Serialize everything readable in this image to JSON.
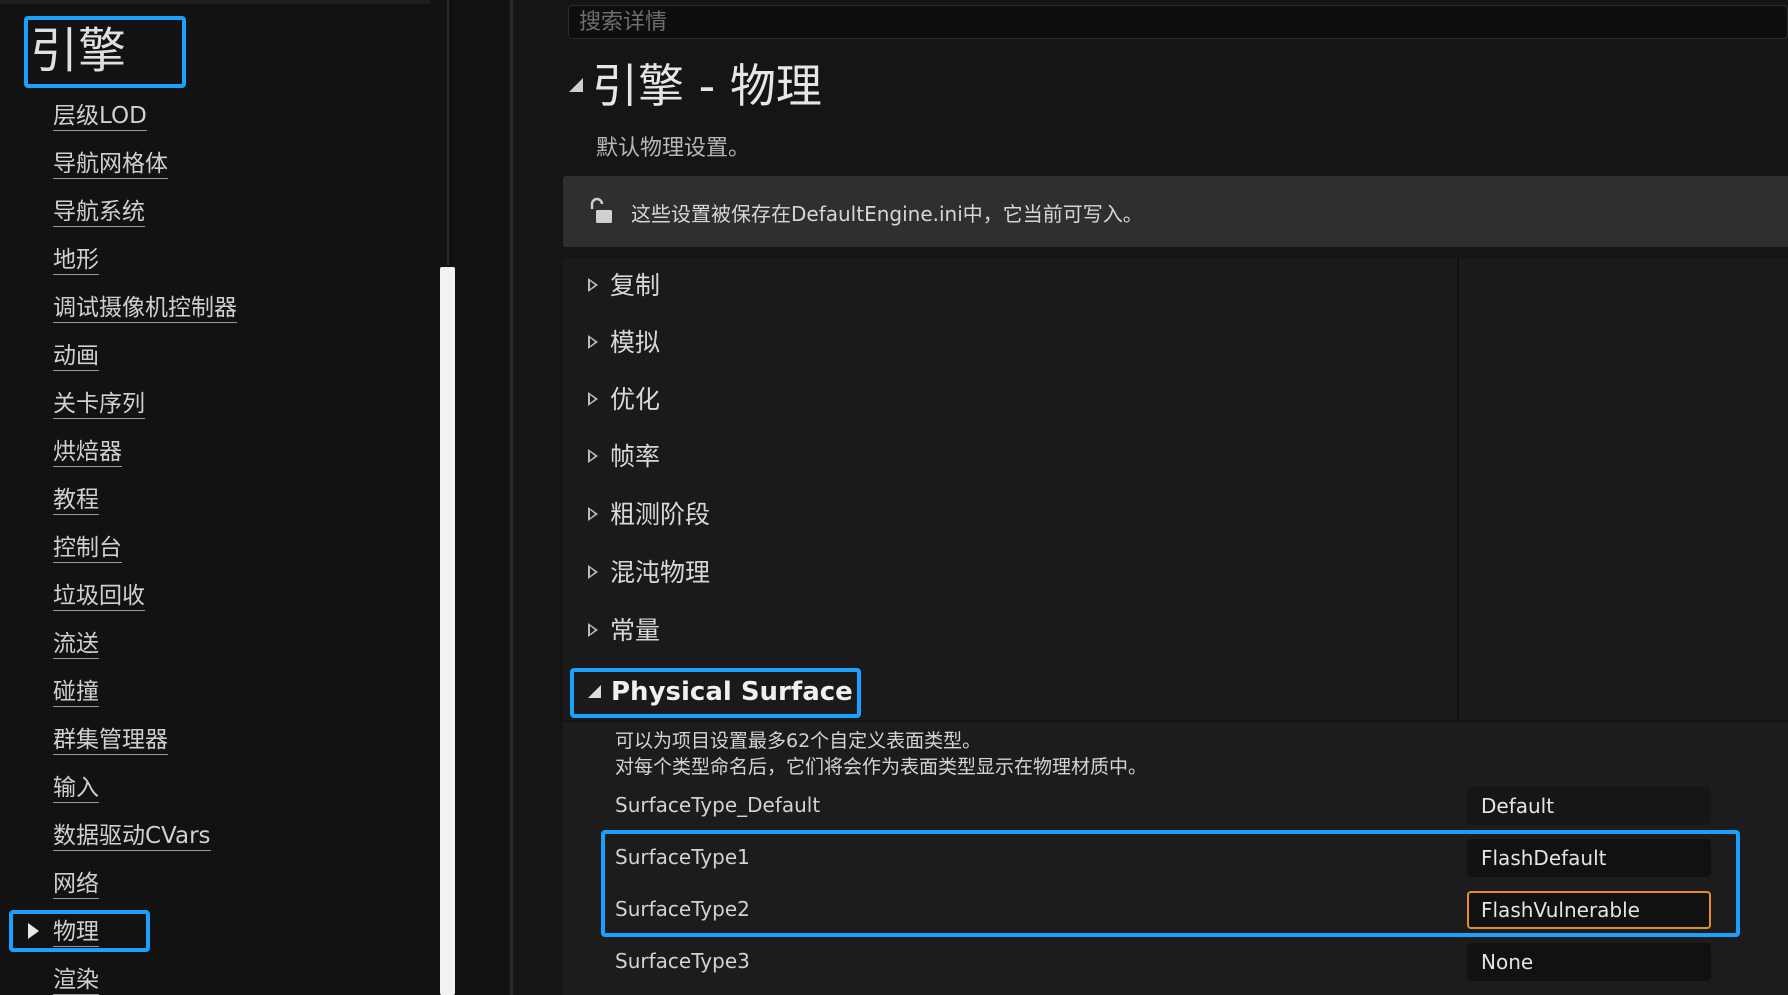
{
  "sidebar": {
    "section_title": "引擎",
    "items": [
      {
        "label": "层级LOD"
      },
      {
        "label": "导航网格体"
      },
      {
        "label": "导航系统"
      },
      {
        "label": "地形"
      },
      {
        "label": "调试摄像机控制器"
      },
      {
        "label": "动画"
      },
      {
        "label": "关卡序列"
      },
      {
        "label": "烘焙器"
      },
      {
        "label": "教程"
      },
      {
        "label": "控制台"
      },
      {
        "label": "垃圾回收"
      },
      {
        "label": "流送"
      },
      {
        "label": "碰撞"
      },
      {
        "label": "群集管理器"
      },
      {
        "label": "输入"
      },
      {
        "label": "数据驱动CVars"
      },
      {
        "label": "网络"
      },
      {
        "label": "物理",
        "active": true
      },
      {
        "label": "渲染"
      }
    ]
  },
  "search": {
    "placeholder": "搜索详情",
    "value": ""
  },
  "page": {
    "title": "引擎 - 物理",
    "description": "默认物理设置。"
  },
  "notice": {
    "icon": "unlock-icon",
    "text": "这些设置被保存在DefaultEngine.ini中，它当前可写入。"
  },
  "categories": [
    {
      "label": "复制"
    },
    {
      "label": "模拟"
    },
    {
      "label": "优化"
    },
    {
      "label": "帧率"
    },
    {
      "label": "粗测阶段"
    },
    {
      "label": "混沌物理"
    },
    {
      "label": "常量"
    }
  ],
  "physical_surface": {
    "title": "Physical Surface",
    "desc_line1": "可以为项目设置最多62个自定义表面类型。",
    "desc_line2": "对每个类型命名后，它们将会作为表面类型显示在物理材质中。",
    "rows": [
      {
        "name": "SurfaceType_Default",
        "value": "Default"
      },
      {
        "name": "SurfaceType1",
        "value": "FlashDefault"
      },
      {
        "name": "SurfaceType2",
        "value": "FlashVulnerable"
      },
      {
        "name": "SurfaceType3",
        "value": "None"
      }
    ]
  },
  "colors": {
    "highlight": "#1aa0ff",
    "focus": "#e68a2e"
  }
}
